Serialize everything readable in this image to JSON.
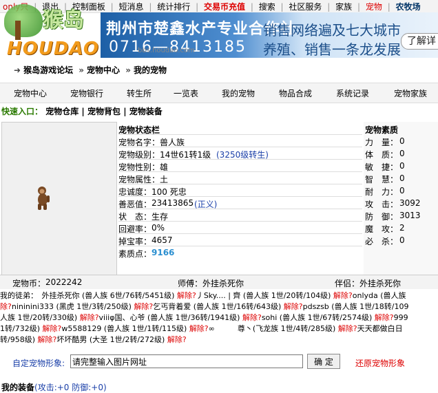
{
  "topbar": {
    "only": "only只",
    "links": [
      "退出",
      "控制面板",
      "短消息",
      "统计排行",
      "交易币充值",
      "搜索",
      "社区服务",
      "家族",
      "宠物",
      "农牧场"
    ]
  },
  "logo": {
    "cn": "猴岛",
    "en": "HOUDAO"
  },
  "banner": {
    "company": "荆州市楚鑫水产专业合作社",
    "phone": "0716—8413185",
    "line1": "销售网络遍及七大城市",
    "line2": "养殖、销售一条龙发展",
    "more": "了解详"
  },
  "watermark": "bbs.houdao.com",
  "breadcrumb": [
    "猴岛游戏论坛",
    "宠物中心",
    "我的宠物"
  ],
  "nav": [
    "宠物中心",
    "宠物银行",
    "转生所",
    "一览表",
    "我的宠物",
    "物品合成",
    "系统记录",
    "宠物家族"
  ],
  "quick": {
    "label": "快速入口：",
    "links": [
      "宠物仓库",
      "宠物背包",
      "宠物装备"
    ]
  },
  "status": {
    "header": "宠物状态栏",
    "name_label": "宠物名字：",
    "name": "兽人族",
    "level_label": "宠物级别：",
    "level": "14世61转1级",
    "level_link": "(3250级转生)",
    "gender_label": "宠物性别：",
    "gender": "雄",
    "attr_label": "宠物属性：",
    "attr": "土",
    "loyalty_label": "忠诚度：",
    "loyalty": "100 死忠",
    "karma_label": "善恶值：",
    "karma": "23413865",
    "karma_link": "(正义)",
    "state_label": "状　态：",
    "state": "生存",
    "dodge_label": "回避率：",
    "dodge": "0%",
    "drop_label": "掉宝率：",
    "drop": "4657",
    "quality_label": "素质点：",
    "quality": "9166"
  },
  "stats": {
    "header": "宠物素质",
    "items": [
      {
        "label": "力　量：",
        "value": "0"
      },
      {
        "label": "体　质：",
        "value": "0"
      },
      {
        "label": "敏　捷：",
        "value": "0"
      },
      {
        "label": "智　慧：",
        "value": "0"
      },
      {
        "label": "耐　力：",
        "value": "0"
      },
      {
        "label": "攻　击：",
        "value": "3092"
      },
      {
        "label": "防　御：",
        "value": "3013"
      },
      {
        "label": "魔　攻：",
        "value": "2"
      },
      {
        "label": "必　杀：",
        "value": "0"
      }
    ]
  },
  "coinbar": {
    "coin_label": "宠物币：",
    "coin": "2022242",
    "master_label": "师傅：",
    "master": "外挂杀死你",
    "partner_label": "伴侣：",
    "partner": "外挂杀死你"
  },
  "apprentices": [
    [
      {
        "t": "我的徒弟：　外挂杀死你 (兽人族 6世/76转/5451级) "
      },
      {
        "t": "解除?",
        "r": 1
      },
      {
        "t": "丿Sky.... | 齊 (兽人族 1世/20转/104级) "
      },
      {
        "t": "解除?",
        "r": 1
      },
      {
        "t": "onlyda (兽人族"
      }
    ],
    [
      {
        "t": "除?",
        "r": 1
      },
      {
        "t": "nininini333 (黑虎 1世/3转/250级) "
      },
      {
        "t": "解除?",
        "r": 1
      },
      {
        "t": "乞丐背着爱 (兽人族 1世/16转/643级) "
      },
      {
        "t": "解除?",
        "r": 1
      },
      {
        "t": "pdszsb (兽人族 1世/18转/109"
      }
    ],
    [
      {
        "t": "人族 1世/20转/330级) "
      },
      {
        "t": "解除?",
        "r": 1
      },
      {
        "t": "viiiφ国、心爷 (兽人族 1世/36转/1941级) "
      },
      {
        "t": "解除?",
        "r": 1
      },
      {
        "t": "sohi (兽人族 1世/67转/2574级) "
      },
      {
        "t": "解除?",
        "r": 1
      },
      {
        "t": "999"
      }
    ],
    [
      {
        "t": "1转/732级) "
      },
      {
        "t": "解除?",
        "r": 1
      },
      {
        "t": "w5588129 (兽人族 1世/1转/115级) "
      },
      {
        "t": "解除?",
        "r": 1
      },
      {
        "t": "∞　　　尊丶(飞龙族 1世/4转/285级) "
      },
      {
        "t": "解除?",
        "r": 1
      },
      {
        "t": "天天都做白日"
      }
    ],
    [
      {
        "t": "转/958级) "
      },
      {
        "t": "解除?",
        "r": 1
      },
      {
        "t": "坏坏酷男 (大圣 1世/2转/272级) "
      },
      {
        "t": "解除?",
        "r": 1
      }
    ]
  ],
  "form": {
    "label": "自定宠物形象:",
    "input_value": "请完整输入图片网址",
    "confirm": "确 定",
    "restore": "还原宠物形象"
  },
  "equip": {
    "label": "我的装备",
    "bonus": "(攻击:+0 防御:+0)"
  }
}
